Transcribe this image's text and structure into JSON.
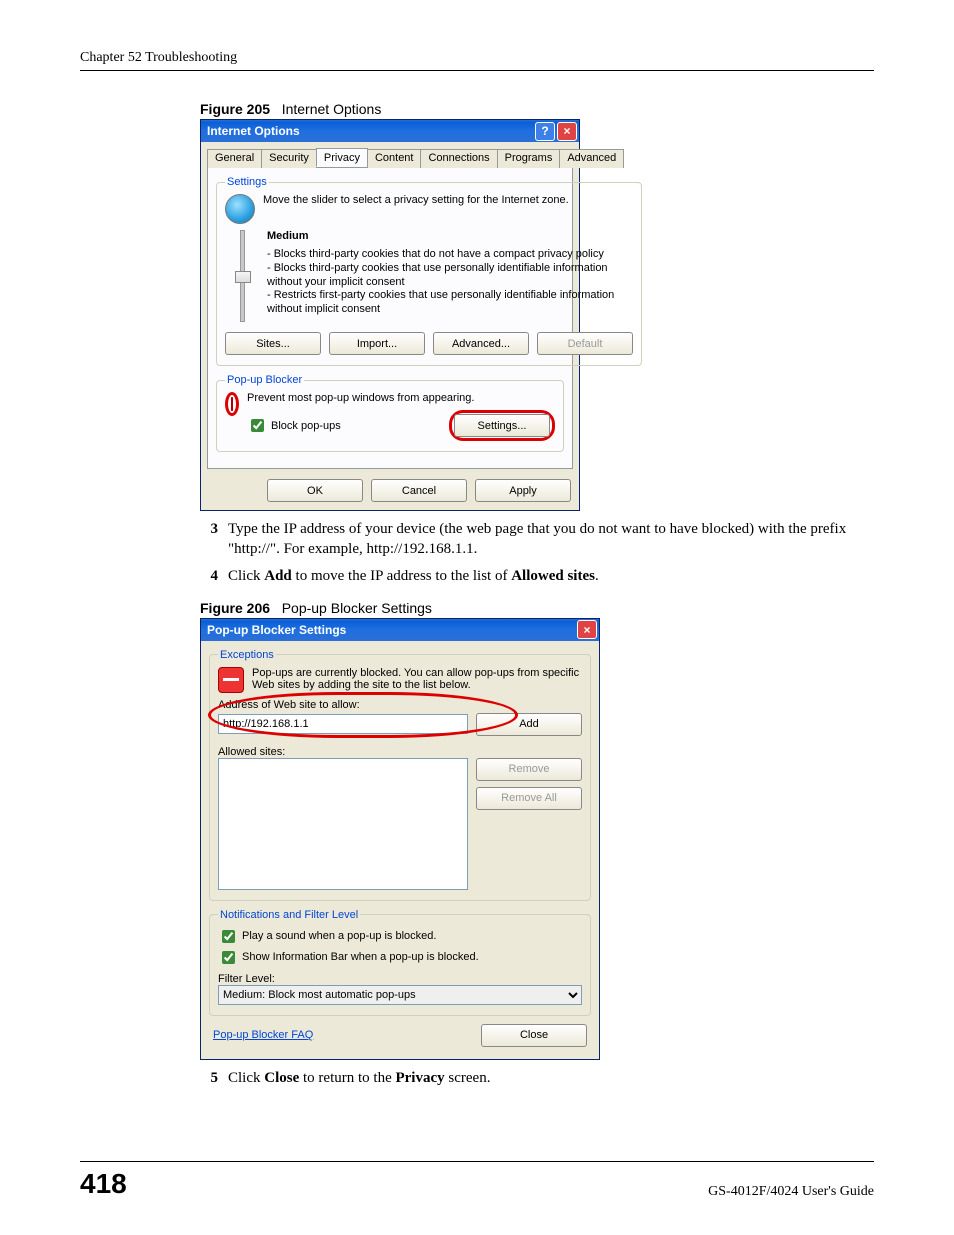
{
  "page": {
    "header": "Chapter 52 Troubleshooting",
    "number": "418",
    "guide": "GS-4012F/4024 User's Guide"
  },
  "fig205": {
    "label": "Figure 205",
    "title": "Internet Options"
  },
  "inetOpts": {
    "title": "Internet Options",
    "tabs": [
      "General",
      "Security",
      "Privacy",
      "Content",
      "Connections",
      "Programs",
      "Advanced"
    ],
    "settings": {
      "legend": "Settings",
      "intro": "Move the slider to select a privacy setting for the Internet zone.",
      "level": "Medium",
      "desc": "- Blocks third-party cookies that do not have a compact privacy policy\n- Blocks third-party cookies that use personally identifiable information without your implicit consent\n- Restricts first-party cookies that use personally identifiable information without implicit consent",
      "btnSites": "Sites...",
      "btnImport": "Import...",
      "btnAdvanced": "Advanced...",
      "btnDefault": "Default"
    },
    "popup": {
      "legend": "Pop-up Blocker",
      "intro": "Prevent most pop-up windows from appearing.",
      "chkBlock": "Block pop-ups",
      "btnSettings": "Settings..."
    },
    "btnOK": "OK",
    "btnCancel": "Cancel",
    "btnApply": "Apply"
  },
  "steps1": {
    "s3": "Type the IP address of your device (the web page that you do not want to have blocked) with the prefix \"http://\". For example, http://192.168.1.1.",
    "s4a": "Click ",
    "s4b": "Add",
    "s4c": " to move the IP address to the list of ",
    "s4d": "Allowed sites",
    "s4e": "."
  },
  "fig206": {
    "label": "Figure 206",
    "title": "Pop-up Blocker Settings"
  },
  "popupDlg": {
    "title": "Pop-up Blocker Settings",
    "exceptions": {
      "legend": "Exceptions",
      "intro": "Pop-ups are currently blocked. You can allow pop-ups from specific Web sites by adding the site to the list below.",
      "labelAddress": "Address of Web site to allow:",
      "value": "http://192.168.1.1",
      "btnAdd": "Add",
      "labelAllowed": "Allowed sites:",
      "btnRemove": "Remove",
      "btnRemoveAll": "Remove All"
    },
    "notif": {
      "legend": "Notifications and Filter Level",
      "chk1": "Play a sound when a pop-up is blocked.",
      "chk2": "Show Information Bar when a pop-up is blocked.",
      "labelFilter": "Filter Level:",
      "filterValue": "Medium: Block most automatic pop-ups"
    },
    "linkFAQ": "Pop-up Blocker FAQ",
    "btnClose": "Close"
  },
  "steps2": {
    "s5a": "Click ",
    "s5b": "Close",
    "s5c": " to return to the ",
    "s5d": "Privacy",
    "s5e": " screen."
  }
}
